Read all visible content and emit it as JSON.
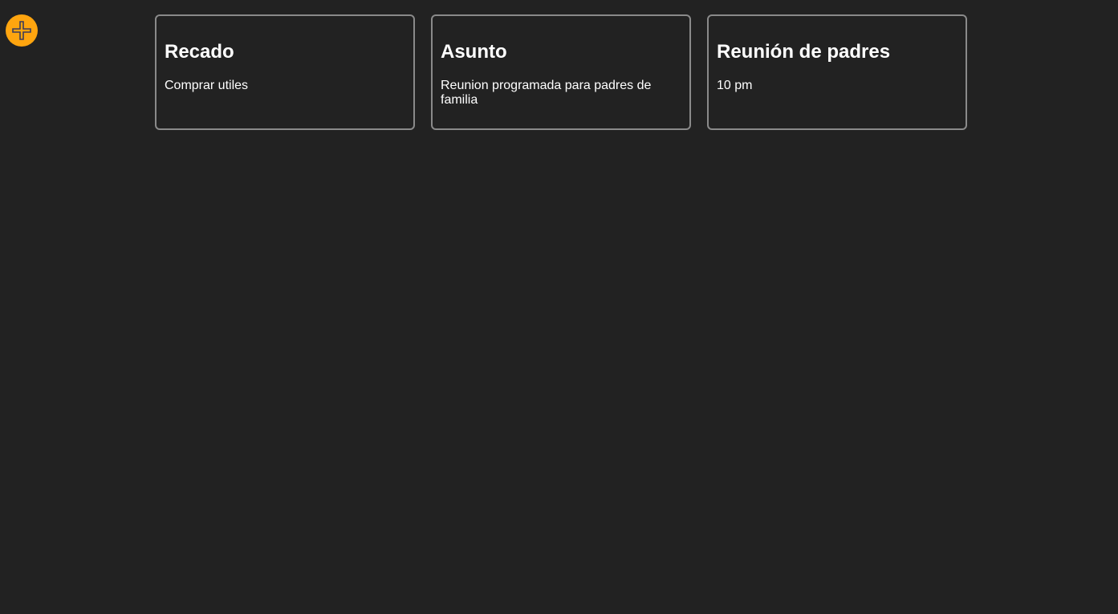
{
  "toolbar": {
    "add_icon": "plus-circle-icon",
    "accent_color": "#ffa50f"
  },
  "notes": [
    {
      "title": "Recado",
      "body": "Comprar utiles"
    },
    {
      "title": "Asunto",
      "body": "Reunion programada para padres de familia"
    },
    {
      "title": "Reunión de padres",
      "body": "10 pm"
    }
  ],
  "colors": {
    "background": "#222222",
    "card_border": "#8a8a8a",
    "text": "#ffffff"
  }
}
